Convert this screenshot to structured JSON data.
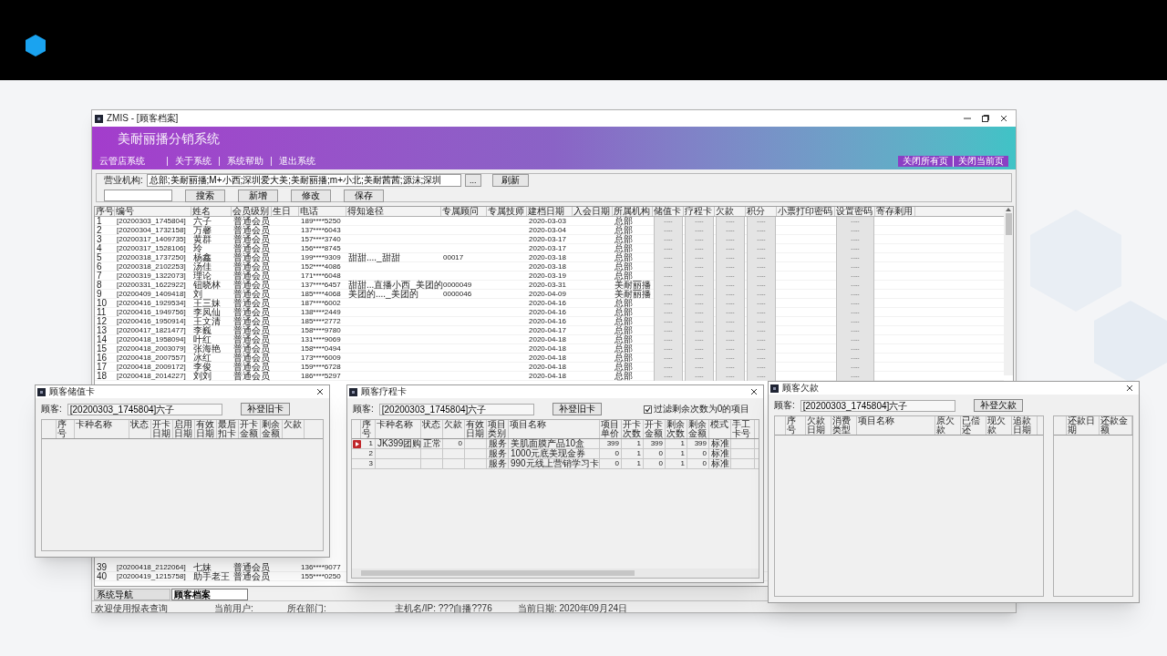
{
  "main_window": {
    "title": "ZMIS - [顾客档案]",
    "app_title": "美耐丽播分销系统",
    "menu": [
      "云管店系统",
      "关于系统",
      "系统帮助",
      "退出系统"
    ],
    "page_actions": [
      "关闭所有页",
      "关闭当前页"
    ],
    "toolbar": {
      "org_label": "营业机构:",
      "org_value": "总部;美耐丽播;M+小西;深圳爱大美;美耐丽播;m+小北;美耐茜茜;源沫;深圳",
      "browse_button": "...",
      "refresh_button": "刷新",
      "search_button": "搜索",
      "add_button": "新增",
      "edit_button": "修改",
      "save_button": "保存"
    },
    "table": {
      "columns": [
        "序号",
        "编号",
        "姓名",
        "会员级别",
        "生日",
        "电话",
        "得知途径",
        "专属顾问",
        "专属技师",
        "建档日期",
        "入会日期",
        "所属机构",
        "储值卡",
        "疗程卡",
        "欠款",
        "积分",
        "小票打印密码",
        "设置密码",
        "寄存剩用"
      ],
      "rows": [
        {
          "no": "1",
          "code": "[20200303_1745804]",
          "name": "六子",
          "level": "普通会员",
          "phone": "189****5250",
          "created": "2020-03-03",
          "org": "总部",
          "stored_card": "----",
          "course_card": "----",
          "debt": "----",
          "points": "----",
          "password": "----"
        },
        {
          "no": "2",
          "code": "[20200304_1732158]",
          "name": "万馨",
          "level": "普通会员",
          "phone": "137****6043",
          "created": "2020-03-04",
          "org": "总部",
          "stored_card": "----",
          "course_card": "----",
          "debt": "----",
          "points": "----",
          "password": "----"
        },
        {
          "no": "3",
          "code": "[20200317_1409735]",
          "name": "黄群",
          "level": "普通会员",
          "phone": "157****3740",
          "created": "2020-03-17",
          "org": "总部",
          "stored_card": "----",
          "course_card": "----",
          "debt": "----",
          "points": "----",
          "password": "----"
        },
        {
          "no": "4",
          "code": "[20200317_1528106]",
          "name": "玲",
          "level": "普通会员",
          "phone": "156****8745",
          "created": "2020-03-17",
          "org": "总部",
          "stored_card": "----",
          "course_card": "----",
          "debt": "----",
          "points": "----",
          "password": "----"
        },
        {
          "no": "5",
          "code": "[20200318_1737250]",
          "name": "杨鑫",
          "level": "普通会员",
          "phone": "199****9309",
          "source": "甜甜...._甜甜",
          "advisor": "00017",
          "created": "2020-03-18",
          "org": "总部",
          "stored_card": "----",
          "course_card": "----",
          "debt": "----",
          "points": "----",
          "password": "----"
        },
        {
          "no": "6",
          "code": "[20200318_2102253]",
          "name": "汤佳",
          "level": "普通会员",
          "phone": "152****4086",
          "created": "2020-03-18",
          "org": "总部",
          "stored_card": "----",
          "course_card": "----",
          "debt": "----",
          "points": "----",
          "password": "----"
        },
        {
          "no": "7",
          "code": "[20200319_1322073]",
          "name": "理论",
          "level": "普通会员",
          "phone": "171****6048",
          "created": "2020-03-19",
          "org": "总部",
          "stored_card": "----",
          "course_card": "----",
          "debt": "----",
          "points": "----",
          "password": "----"
        },
        {
          "no": "8",
          "code": "[20200331_1622922]",
          "name": "钮晓林",
          "level": "普通会员",
          "phone": "137****6457",
          "source": "甜甜...直播小西_美团的",
          "advisor": "0000049",
          "created": "2020-03-31",
          "org": "美耐丽播",
          "stored_card": "----",
          "course_card": "----",
          "debt": "----",
          "points": "----",
          "password": "----"
        },
        {
          "no": "9",
          "code": "[20200409_1409418]",
          "name": "刘",
          "level": "普通会员",
          "phone": "185****4068",
          "source": "美团的...._美团的",
          "advisor": "0000046",
          "created": "2020-04-09",
          "org": "美耐丽播",
          "stored_card": "----",
          "course_card": "----",
          "debt": "----",
          "points": "----",
          "password": "----"
        },
        {
          "no": "10",
          "code": "[20200416_1929534]",
          "name": "王三妹",
          "level": "普通会员",
          "phone": "187****6002",
          "created": "2020-04-16",
          "org": "总部",
          "stored_card": "----",
          "course_card": "----",
          "debt": "----",
          "points": "----",
          "password": "----"
        },
        {
          "no": "11",
          "code": "[20200416_1949756]",
          "name": "李凤仙",
          "level": "普通会员",
          "phone": "138****2449",
          "created": "2020-04-16",
          "org": "总部",
          "stored_card": "----",
          "course_card": "----",
          "debt": "----",
          "points": "----",
          "password": "----"
        },
        {
          "no": "12",
          "code": "[20200416_1950914]",
          "name": "王文清",
          "level": "普通会员",
          "phone": "185****2772",
          "created": "2020-04-16",
          "org": "总部",
          "stored_card": "----",
          "course_card": "----",
          "debt": "----",
          "points": "----",
          "password": "----"
        },
        {
          "no": "13",
          "code": "[20200417_1821477]",
          "name": "李巍",
          "level": "普通会员",
          "phone": "158****9780",
          "created": "2020-04-17",
          "org": "总部",
          "stored_card": "----",
          "course_card": "----",
          "debt": "----",
          "points": "----",
          "password": "----"
        },
        {
          "no": "14",
          "code": "[20200418_1958094]",
          "name": "叶红",
          "level": "普通会员",
          "phone": "131****9069",
          "created": "2020-04-18",
          "org": "总部",
          "stored_card": "----",
          "course_card": "----",
          "debt": "----",
          "points": "----",
          "password": "----"
        },
        {
          "no": "15",
          "code": "[20200418_2003079]",
          "name": "张海艳",
          "level": "普通会员",
          "phone": "158****0494",
          "created": "2020-04-18",
          "org": "总部",
          "stored_card": "----",
          "course_card": "----",
          "debt": "----",
          "points": "----",
          "password": "----"
        },
        {
          "no": "16",
          "code": "[20200418_2007557]",
          "name": "冰红",
          "level": "普通会员",
          "phone": "173****6009",
          "created": "2020-04-18",
          "org": "总部",
          "stored_card": "----",
          "course_card": "----",
          "debt": "----",
          "points": "----",
          "password": "----"
        },
        {
          "no": "17",
          "code": "[20200418_2009172]",
          "name": "李俊",
          "level": "普通会员",
          "phone": "159****6728",
          "created": "2020-04-18",
          "org": "总部",
          "stored_card": "----",
          "course_card": "----",
          "debt": "----",
          "points": "----",
          "password": "----"
        },
        {
          "no": "18",
          "code": "[20200418_2014227]",
          "name": "刘刘",
          "level": "普通会员",
          "phone": "186****5297",
          "created": "2020-04-18",
          "org": "总部",
          "stored_card": "----",
          "course_card": "----",
          "debt": "----",
          "points": "----",
          "password": "----"
        }
      ],
      "bottom_rows": [
        {
          "no": "39",
          "code": "[20200418_2122064]",
          "name": "七妹",
          "level": "普通会员",
          "phone": "136****9077"
        },
        {
          "no": "40",
          "code": "[20200419_1215758]",
          "name": "助手老王",
          "level": "普通会员",
          "phone": "155****0250"
        }
      ]
    },
    "tabs": [
      {
        "label": "系统导航",
        "selected": false
      },
      {
        "label": "顾客档案",
        "selected": true
      }
    ],
    "status_bar": [
      "欢迎使用报表查询",
      "当前用户:",
      "所在部门:",
      "主机名/IP: ???自播??76",
      "当前日期: 2020年09月24日"
    ]
  },
  "stored_card_dialog": {
    "title": "顾客储值卡",
    "customer_label": "顾客:",
    "customer_value": "[20200303_1745804]六子",
    "button": "补登旧卡",
    "columns": [
      "序号",
      "卡种名称",
      "状态",
      "开卡日期",
      "启用日期",
      "有效日期",
      "最后扣卡",
      "开卡金额",
      "剩余金额",
      "欠款"
    ]
  },
  "course_card_dialog": {
    "title": "顾客疗程卡",
    "customer_label": "顾客:",
    "customer_value": "[20200303_1745804]六子",
    "button": "补登旧卡",
    "filter": {
      "label": "过滤剩余次数为0的项目",
      "checked": true
    },
    "columns": [
      "序号",
      "卡种名称",
      "状态",
      "欠款",
      "有效日期",
      "项目类别",
      "项目名称",
      "项目单价",
      "开卡次数",
      "开卡金额",
      "剩余次数",
      "剩余金额",
      "模式",
      "手工卡号"
    ],
    "rows": [
      {
        "selected": true,
        "no": "1",
        "card": "JK399团购",
        "status": "正常",
        "debt": "0",
        "category": "服务",
        "item": "美肌面膜产品10盒",
        "price": "399",
        "open_count": "1",
        "open_amount": "399",
        "remain_count": "1",
        "remain_amount": "399",
        "mode": "标准"
      },
      {
        "selected": false,
        "no": "2",
        "category": "服务",
        "item": "1000元底美现金券",
        "price": "0",
        "open_count": "1",
        "open_amount": "0",
        "remain_count": "1",
        "remain_amount": "0",
        "mode": "标准"
      },
      {
        "selected": false,
        "no": "3",
        "category": "服务",
        "item": "990元线上营销学习卡",
        "price": "0",
        "open_count": "1",
        "open_amount": "0",
        "remain_count": "1",
        "remain_amount": "0",
        "mode": "标准"
      }
    ]
  },
  "debt_dialog": {
    "title": "顾客欠款",
    "customer_label": "顾客:",
    "customer_value": "[20200303_1745804]六子",
    "button": "补登欠款",
    "columns": [
      "序号",
      "欠款日期",
      "消费类型",
      "项目名称",
      "原欠款",
      "已偿还",
      "现欠款",
      "追款日期"
    ],
    "repayment_columns": [
      "还款日期",
      "还款金额"
    ]
  }
}
